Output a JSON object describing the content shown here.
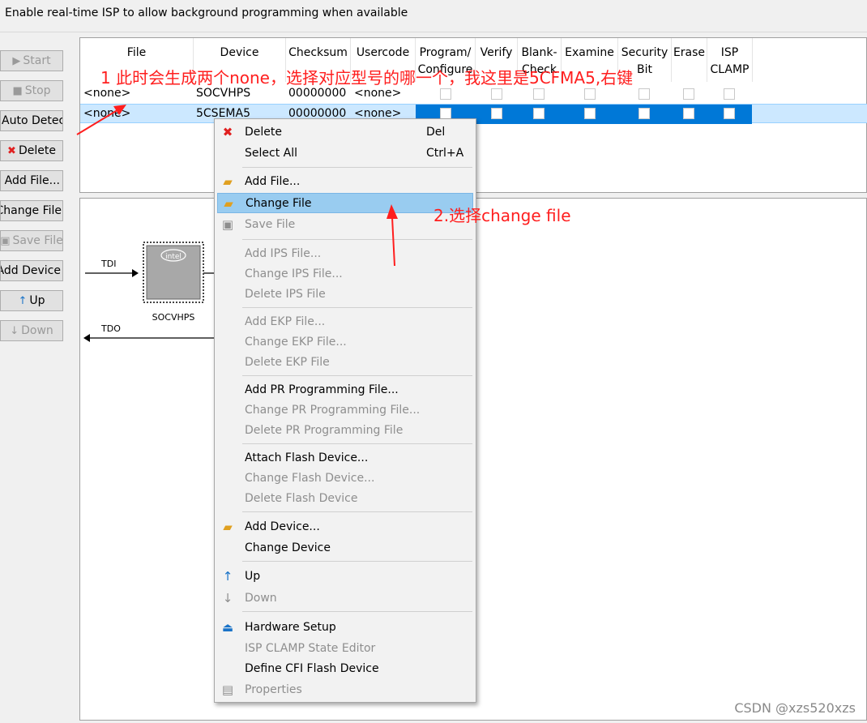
{
  "topbar": {
    "checkbox_label": "Enable real-time ISP to allow background programming when available"
  },
  "sidebar": {
    "start": "Start",
    "stop": "Stop",
    "auto_detect": "Auto Detec",
    "delete": "Delete",
    "add_file": "Add File...",
    "change_file": "Change File",
    "save_file": "Save File",
    "add_device": "Add Device",
    "up": "Up",
    "down": "Down"
  },
  "table": {
    "headers": {
      "file": "File",
      "device": "Device",
      "checksum": "Checksum",
      "usercode": "Usercode",
      "program": "Program/\nConfigure",
      "verify": "Verify",
      "blank_check": "Blank-\nCheck",
      "examine": "Examine",
      "security": "Security\nBit",
      "erase": "Erase",
      "isp": "ISP\nCLAMP"
    },
    "rows": [
      {
        "file": "<none>",
        "device": "SOCVHPS",
        "checksum": "00000000",
        "usercode": "<none>"
      },
      {
        "file": "<none>",
        "device": "5CSEMA5",
        "checksum": "00000000",
        "usercode": "<none>"
      }
    ]
  },
  "diagram": {
    "tdi_label": "TDI",
    "tdo_label": "TDO",
    "chip_label": "SOCVHPS",
    "chip_brand": "intel"
  },
  "menu": {
    "delete": "Delete",
    "delete_shortcut": "Del",
    "select_all": "Select All",
    "select_all_shortcut": "Ctrl+A",
    "add_file": "Add File...",
    "change_file": "Change File",
    "save_file": "Save File",
    "add_ips": "Add IPS File...",
    "change_ips": "Change IPS File...",
    "delete_ips": "Delete IPS File",
    "add_ekp": "Add EKP File...",
    "change_ekp": "Change EKP File...",
    "delete_ekp": "Delete EKP File",
    "add_pr": "Add PR Programming File...",
    "change_pr": "Change PR Programming File...",
    "delete_pr": "Delete PR Programming File",
    "attach_flash": "Attach Flash Device...",
    "change_flash": "Change Flash Device...",
    "delete_flash": "Delete Flash Device",
    "add_device": "Add Device...",
    "change_device": "Change Device",
    "up": "Up",
    "down": "Down",
    "hardware_setup": "Hardware Setup",
    "isp_clamp": "ISP CLAMP State Editor",
    "define_cfi": "Define CFI Flash Device",
    "properties": "Properties"
  },
  "annotations": {
    "note1": "1 此时会生成两个none，选择对应型号的哪一个，我这里是5CFMA5,右键",
    "note2": "2.选择change file"
  },
  "watermark": "CSDN @xzs520xzs",
  "colors": {
    "selection": "#0078d7",
    "highlight": "#99ccf0",
    "annotation": "#ff1e1e"
  }
}
